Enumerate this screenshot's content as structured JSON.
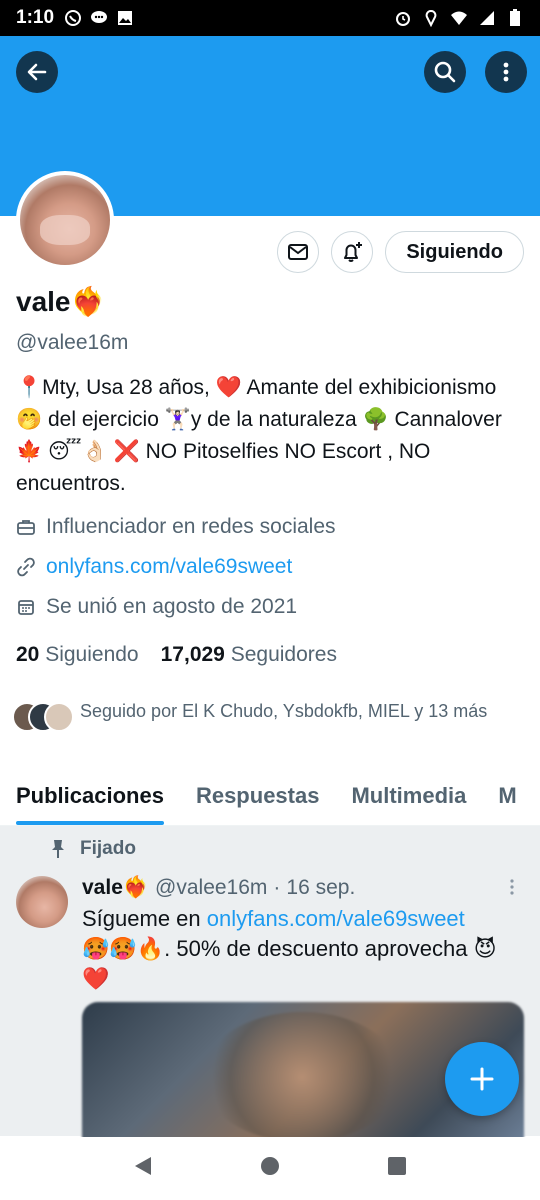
{
  "status_bar": {
    "time": "1:10",
    "left_icons": [
      "whatsapp-icon",
      "chat-icon",
      "image-icon"
    ],
    "right_icons": [
      "alarm-icon",
      "location-icon",
      "wifi-icon",
      "signal-icon",
      "battery-icon"
    ]
  },
  "header": {
    "back_icon": "arrow-left-icon",
    "search_icon": "search-icon",
    "more_icon": "more-vertical-icon",
    "banner_color": "#1d9bf0"
  },
  "profile": {
    "display_name": "vale❤️‍🔥",
    "handle": "@valee16m",
    "follow_button_label": "Siguiendo",
    "bio": "📍Mty, Usa 28 años, ❤️ Amante del exhibicionismo🤭 del ejercicio 🏋🏻‍♀️y de la naturaleza 🌳 Cannalover🍁 😴👌🏻 ❌ NO Pitoselfies NO Escort , NO encuentros.",
    "category": "Influenciador en redes sociales",
    "website": "onlyfans.com/vale69sweet",
    "joined": "Se unió en agosto de 2021",
    "following_count": "20",
    "following_label": "Siguiendo",
    "followers_count": "17,029",
    "followers_label": "Seguidores",
    "followed_by_text": "Seguido por El K Chudo, Ysbdokfb, MIEL y 13 más"
  },
  "tabs": [
    {
      "label": "Publicaciones",
      "active": true
    },
    {
      "label": "Respuestas",
      "active": false
    },
    {
      "label": "Multimedia",
      "active": false
    },
    {
      "label": "M",
      "active": false
    }
  ],
  "pinned_tweet": {
    "pinned_label": "Fijado",
    "author_name": "vale❤️‍🔥",
    "author_handle": "@valee16m",
    "separator": "·",
    "date": "16 sep.",
    "text_before_link": "Sígueme en ",
    "link": "onlyfans.com/vale69sweet",
    "text_after_link": "🥵🥵🔥. 50% de descuento aprovecha 😈❤️"
  },
  "fab_icon": "plus-icon",
  "nav_bar": [
    "back-triangle-icon",
    "home-circle-icon",
    "recents-square-icon"
  ],
  "colors": {
    "accent": "#1d9bf0",
    "secondary_text": "#536471",
    "primary_text": "#0f1419"
  }
}
